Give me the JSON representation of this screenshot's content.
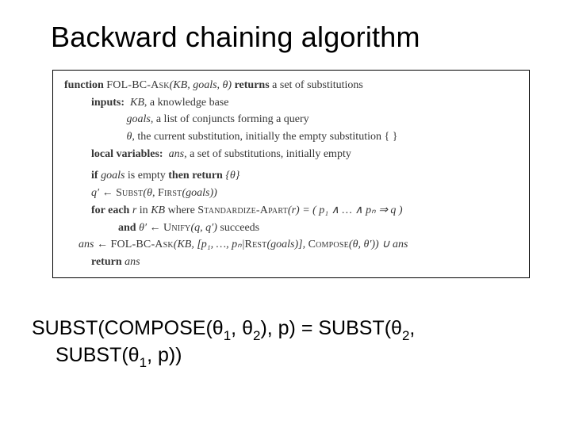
{
  "title": "Backward chaining algorithm",
  "algo": {
    "l1_kw": "function",
    "l1_fn": "FOL-BC-Ask",
    "l1_args": "(KB, goals, θ)",
    "l1_ret_kw": " returns ",
    "l1_ret": "a set of substitutions",
    "inputs_kw": "inputs:",
    "in1_var": "KB",
    "in1_txt": ", a knowledge base",
    "in2_var": "goals",
    "in2_txt": ", a list of conjuncts forming a query",
    "in3_var": "θ",
    "in3_txt": ", the current substitution, initially the empty substitution { }",
    "locals_kw": "local variables:",
    "loc_var": "ans",
    "loc_txt": ", a set of substitutions, initially empty",
    "if_kw": "if ",
    "if_var": "goals",
    "if_mid": " is empty ",
    "then_kw": "then return ",
    "if_ret": "{θ}",
    "l_qprime": "q′ ← ",
    "subst_fn": "Subst",
    "l_qprime_args_a": "(θ, ",
    "first_fn": "First",
    "l_qprime_args_b": "(goals))",
    "for_kw": "for each ",
    "for_var": "r",
    "for_in": " in ",
    "for_kb": "KB",
    "for_where": " where ",
    "std_fn": "Standardize-Apart",
    "for_tail": "(r) = ( p₁ ∧ … ∧ pₙ ⇒ q )",
    "and_kw": "and ",
    "and_var": "θ′ ← ",
    "unify_fn": "Unify",
    "and_args": "(q, q′)",
    "and_tail": " succeeds",
    "ans_line_a": "ans ← ",
    "ans_fn": "FOL-BC-Ask",
    "ans_args_a": "(KB, [p₁, …, pₙ|",
    "rest_fn": "Rest",
    "ans_args_b": "(goals)], ",
    "compose_fn": "Compose",
    "ans_args_c": "(θ, θ′)) ∪ ans",
    "ret_kw": "return ",
    "ret_var": "ans"
  },
  "equation": {
    "l1_a": "SUBST(COMPOSE(θ",
    "l1_s1": "1",
    "l1_b": ", θ",
    "l1_s2": "2",
    "l1_c": "), p) = SUBST(θ",
    "l1_s3": "2",
    "l1_d": ",",
    "l2_a": "SUBST(θ",
    "l2_s1": "1",
    "l2_b": ", p))"
  }
}
